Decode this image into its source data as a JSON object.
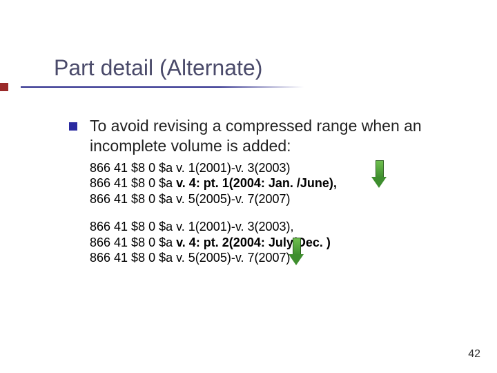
{
  "title": "Part detail (Alternate)",
  "lead": "To avoid revising a compressed range when an incomplete volume is added:",
  "block1": {
    "l1_pre": "866 41 $8 0 $a v. 1(2001)-v. 3(2003)",
    "l2_pre": "866 41 $8 0 $a ",
    "l2_bold": "v. 4: pt. 1(2004: Jan. /June),",
    "l3_pre": "866 41 $8 0 $a v. 5(2005)-v. 7(2007)"
  },
  "block2": {
    "l1_pre": "866 41 $8 0 $a v. 1(2001)-v. 3(2003),",
    "l2_pre": "866 41 $8 0 $a ",
    "l2_bold": "v. 4: pt. 2(2004: July/Dec. )",
    "l3_pre": "866 41 $8 0 $a v. 5(2005)-v. 7(2007)"
  },
  "page_number": "42"
}
